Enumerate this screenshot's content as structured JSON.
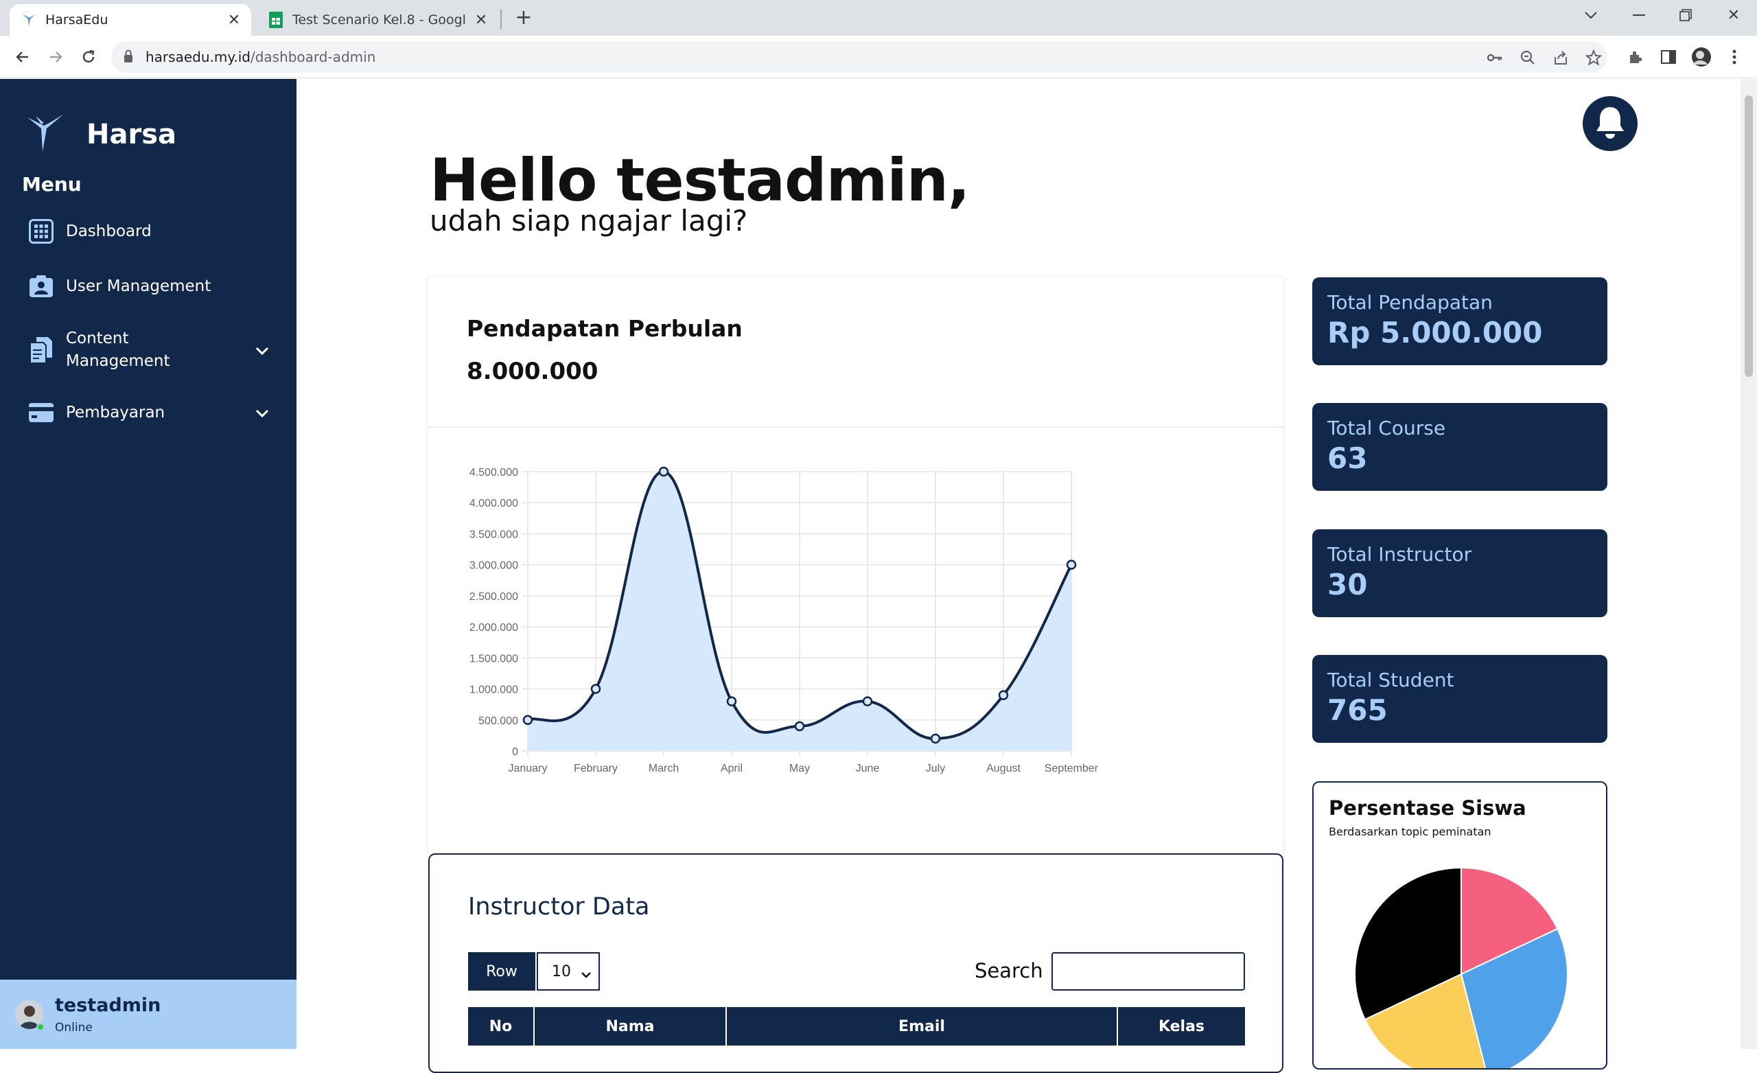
{
  "browser": {
    "tabs": [
      {
        "title": "HarsaEdu",
        "active": true
      },
      {
        "title": "Test Scenario Kel.8 - Google Spreadsheets",
        "active": false
      }
    ],
    "url_host": "harsaedu.my.id",
    "url_path": "/dashboard-admin"
  },
  "sidebar": {
    "brand": "Harsa",
    "menu_heading": "Menu",
    "items": [
      {
        "label": "Dashboard",
        "icon": "grid-icon"
      },
      {
        "label": "User Management",
        "icon": "user-card-icon"
      },
      {
        "label": "Content\nManagement",
        "icon": "documents-icon",
        "expandable": true
      },
      {
        "label": "Pembayaran",
        "icon": "card-icon",
        "expandable": true
      }
    ],
    "user": {
      "name": "testadmin",
      "status": "Online"
    }
  },
  "header": {
    "greeting": "Hello testadmin,",
    "subgreeting": "udah siap ngajar lagi?"
  },
  "income": {
    "title": "Pendapatan Perbulan",
    "value": "8.000.000"
  },
  "stats": [
    {
      "label": "Total Pendapatan",
      "value": "Rp 5.000.000"
    },
    {
      "label": "Total Course",
      "value": "63"
    },
    {
      "label": "Total Instructor",
      "value": "30"
    },
    {
      "label": "Total Student",
      "value": "765"
    }
  ],
  "student_pie": {
    "title": "Persentase Siswa",
    "subtitle": "Berdasarkan topic peminatan"
  },
  "instructor": {
    "title": "Instructor Data",
    "row_button": "Row",
    "row_value": "10",
    "search_label": "Search",
    "columns": [
      "No",
      "Nama",
      "Email",
      "Kelas"
    ]
  },
  "colors": {
    "navy": "#12284a",
    "light_blue": "#a8cdf7",
    "chart_fill": "#d6e8fb"
  },
  "chart_data": [
    {
      "type": "area",
      "categories": [
        "January",
        "February",
        "March",
        "April",
        "May",
        "June",
        "July",
        "August",
        "September"
      ],
      "values": [
        500000,
        1000000,
        4500000,
        800000,
        400000,
        800000,
        200000,
        900000,
        3000000
      ],
      "y_tick_labels": [
        "0",
        "500.000",
        "1.000.000",
        "1.500.000",
        "2.000.000",
        "2.500.000",
        "3.000.000",
        "3.500.000",
        "4.000.000",
        "4.500.000"
      ],
      "ylim": [
        0,
        4500000
      ],
      "grid": true,
      "legend": "none"
    },
    {
      "type": "pie",
      "values": [
        18,
        28,
        22,
        32
      ],
      "colors": [
        "#f5607f",
        "#4fa1ea",
        "#fbcf57",
        "#000000"
      ]
    }
  ]
}
